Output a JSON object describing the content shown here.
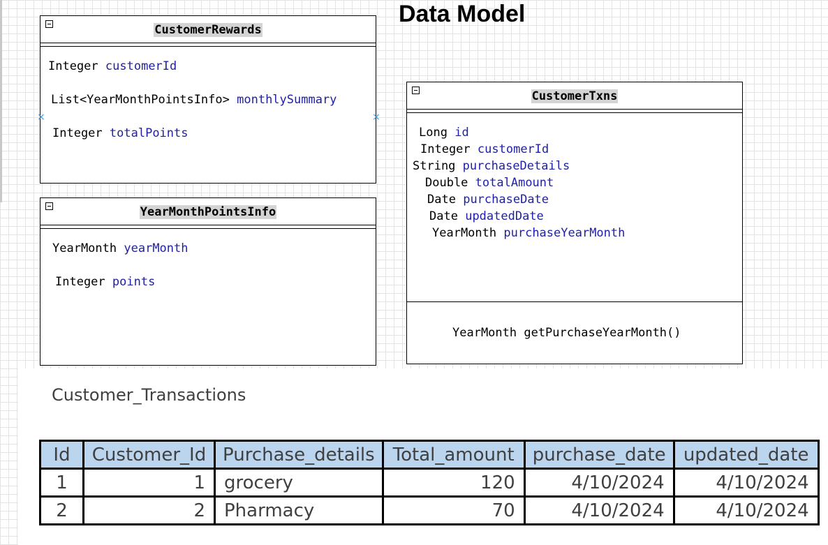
{
  "title": "Data Model",
  "classes": {
    "customer_rewards": {
      "name": "CustomerRewards",
      "attributes": [
        {
          "type": "Integer",
          "name": "customerId"
        },
        {
          "type": "List<YearMonthPointsInfo>",
          "name": "monthlySummary"
        },
        {
          "type": "Integer",
          "name": "totalPoints"
        }
      ]
    },
    "year_month_points_info": {
      "name": "YearMonthPointsInfo",
      "attributes": [
        {
          "type": "YearMonth",
          "name": "yearMonth"
        },
        {
          "type": "Integer",
          "name": "points"
        }
      ]
    },
    "customer_txns": {
      "name": "CustomerTxns",
      "attributes": [
        {
          "type": "Long",
          "name": "id"
        },
        {
          "type": "Integer",
          "name": "customerId"
        },
        {
          "type": "String",
          "name": "purchaseDetails"
        },
        {
          "type": "Double",
          "name": "totalAmount"
        },
        {
          "type": "Date",
          "name": "purchaseDate"
        },
        {
          "type": "Date",
          "name": "updatedDate"
        },
        {
          "type": "YearMonth",
          "name": "purchaseYearMonth"
        }
      ],
      "methods": [
        "YearMonth getPurchaseYearMonth()"
      ]
    }
  },
  "table": {
    "title": "Customer_Transactions",
    "headers": [
      "Id",
      "Customer_Id",
      "Purchase_details",
      "Total_amount",
      "purchase_date",
      "updated_date"
    ],
    "rows": [
      [
        "1",
        "1",
        "grocery",
        "120",
        "4/10/2024",
        "4/10/2024"
      ],
      [
        "2",
        "2",
        "Pharmacy",
        "70",
        "4/10/2024",
        "4/10/2024"
      ]
    ]
  }
}
